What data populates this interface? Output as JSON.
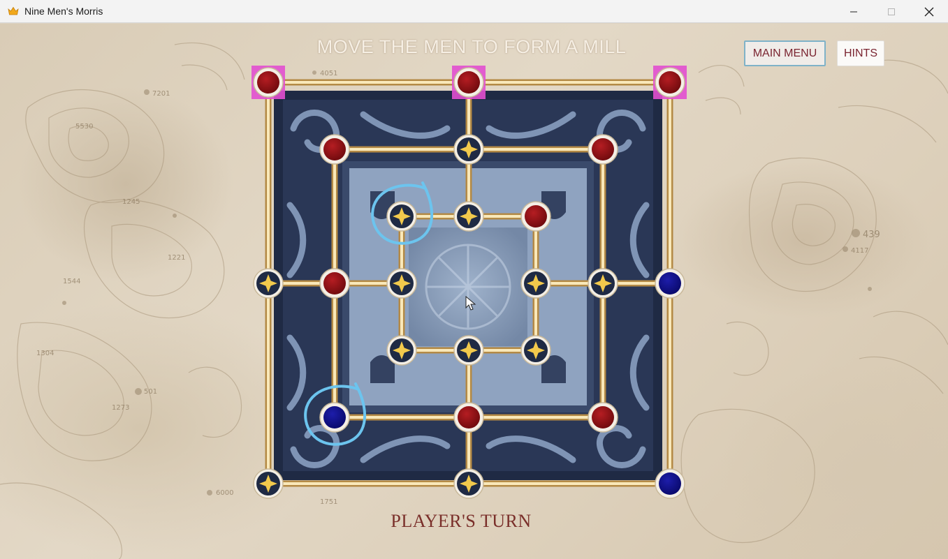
{
  "window": {
    "title": "Nine Men's Morris",
    "icon": "crown-icon",
    "controls": [
      "minimize-icon",
      "maximize-icon",
      "close-icon"
    ]
  },
  "game": {
    "instruction": "MOVE THE MEN TO FORM A MILL",
    "main_menu_label": "MAIN MENU",
    "hints_label": "HINTS",
    "status": "PLAYER'S TURN"
  },
  "map_labels": [
    "4051",
    "7201",
    "5530",
    "1245",
    "1221",
    "1544",
    "1304",
    "501",
    "1273",
    "6000",
    "1751",
    "439",
    "4117"
  ],
  "colors": {
    "red_piece": "#8e0d12",
    "blue_piece": "#0d0d83",
    "empty_star": "#f2c94c",
    "highlight": "#e24fd0",
    "annotation": "#6cc4ee"
  },
  "board": {
    "points": [
      {
        "id": "a7",
        "state": "red",
        "highlighted": true
      },
      {
        "id": "d7",
        "state": "red",
        "highlighted": true
      },
      {
        "id": "g7",
        "state": "red",
        "highlighted": true
      },
      {
        "id": "b6",
        "state": "red"
      },
      {
        "id": "d6",
        "state": "empty"
      },
      {
        "id": "f6",
        "state": "red"
      },
      {
        "id": "c5",
        "state": "empty",
        "circled": true
      },
      {
        "id": "d5",
        "state": "empty"
      },
      {
        "id": "e5",
        "state": "red"
      },
      {
        "id": "a4",
        "state": "empty"
      },
      {
        "id": "b4",
        "state": "red"
      },
      {
        "id": "c4",
        "state": "empty"
      },
      {
        "id": "e4",
        "state": "empty"
      },
      {
        "id": "f4",
        "state": "empty"
      },
      {
        "id": "g4",
        "state": "blue"
      },
      {
        "id": "c3",
        "state": "empty"
      },
      {
        "id": "d3",
        "state": "empty"
      },
      {
        "id": "e3",
        "state": "empty"
      },
      {
        "id": "b2",
        "state": "blue",
        "circled": true
      },
      {
        "id": "d2",
        "state": "red"
      },
      {
        "id": "f2",
        "state": "red"
      },
      {
        "id": "a1",
        "state": "empty"
      },
      {
        "id": "d1",
        "state": "empty"
      },
      {
        "id": "g1",
        "state": "blue"
      }
    ]
  }
}
